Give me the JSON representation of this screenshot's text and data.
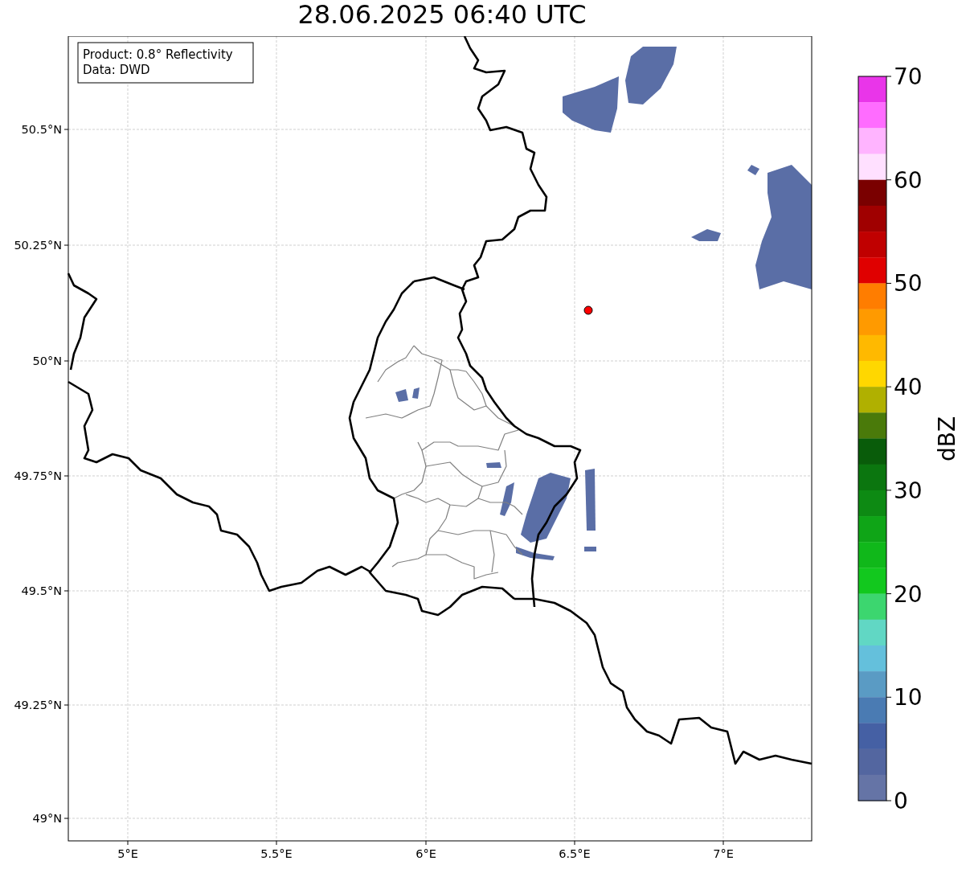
{
  "title": "28.06.2025 06:40 UTC",
  "info_box": [
    "Product: 0.8° Reflectivity",
    "Data: DWD"
  ],
  "map": {
    "lat_ticks": [
      "50.5°N",
      "50.25°N",
      "50°N",
      "49.75°N",
      "49.5°N",
      "49.25°N",
      "49°N"
    ],
    "lon_ticks": [
      "5°E",
      "5.5°E",
      "6°E",
      "6.5°E",
      "7°E"
    ]
  },
  "colorbar": {
    "label": "dBZ",
    "ticks": [
      "70",
      "60",
      "50",
      "40",
      "30",
      "20",
      "10",
      "0"
    ],
    "segments": [
      {
        "color": "#e935e9"
      },
      {
        "color": "#ff6cff"
      },
      {
        "color": "#ffb4ff"
      },
      {
        "color": "#ffe0ff"
      },
      {
        "color": "#7a0000"
      },
      {
        "color": "#a00000"
      },
      {
        "color": "#c00000"
      },
      {
        "color": "#e00000"
      },
      {
        "color": "#ff7d00"
      },
      {
        "color": "#ff9a00"
      },
      {
        "color": "#ffb900"
      },
      {
        "color": "#ffd700"
      },
      {
        "color": "#b0b000"
      },
      {
        "color": "#4a7a0a"
      },
      {
        "color": "#095c0a"
      },
      {
        "color": "#0b760f"
      },
      {
        "color": "#0d8a13"
      },
      {
        "color": "#0fa517"
      },
      {
        "color": "#10b81a"
      },
      {
        "color": "#12c81e"
      },
      {
        "color": "#3cd66f"
      },
      {
        "color": "#61d7c4"
      },
      {
        "color": "#64c0dc"
      },
      {
        "color": "#5a9bc4"
      },
      {
        "color": "#4a7bb3"
      },
      {
        "color": "#4560a4"
      },
      {
        "color": "#5366a0"
      },
      {
        "color": "#6574a6"
      }
    ]
  }
}
